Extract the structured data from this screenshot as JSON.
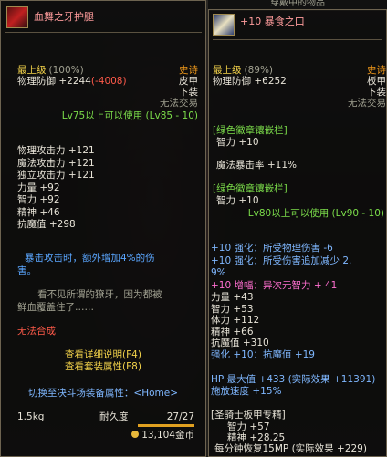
{
  "left": {
    "name": "血舞之牙护腿",
    "level_label": "最上级",
    "level_pct": "(100%)",
    "rarity": "史诗",
    "phys_def_label": "物理防御",
    "phys_def_val": "+2244",
    "phys_def_diff": "(-4008)",
    "material": "皮甲",
    "slot": "下装",
    "trade": "无法交易",
    "req": "Lv75以上可以使用 (Lv85 - 10)",
    "stats": [
      {
        "label": "物理攻击力",
        "val": "+121"
      },
      {
        "label": "魔法攻击力",
        "val": "+121"
      },
      {
        "label": "独立攻击力",
        "val": "+121"
      },
      {
        "label": "力量",
        "val": "+92"
      },
      {
        "label": "智力",
        "val": "+92"
      },
      {
        "label": "精神",
        "val": "+46"
      },
      {
        "label": "抗魔值",
        "val": "+298"
      }
    ],
    "effect1": "暴击攻击时，额外增加4%的伤",
    "effect2": "害。",
    "flavor1": "看不见所谓的獠牙，因为都被",
    "flavor2": "鲜血覆盖住了……",
    "no_synth": "无法合成",
    "link_detail": "查看详细说明(F4)",
    "link_set": "查看套装属性(F8)",
    "switch_label": "切换至决斗场装备属性：<Home>",
    "weight": "1.5kg",
    "durability_label": "耐久度",
    "durability_val": "27/27",
    "durability_fraction": 1.0,
    "price": "13,104金币"
  },
  "right": {
    "header": "穿戴中的物品",
    "name": "+10 暴食之口",
    "level_label": "最上级",
    "level_pct": "(89%)",
    "rarity": "史诗",
    "phys_def_label": "物理防御",
    "phys_def_val": "+6252",
    "material": "板甲",
    "slot": "下装",
    "trade": "无法交易",
    "slot1_title": "[绿色徽章镶嵌栏]",
    "slot1_stat": "智力 +10",
    "slot1_extra": "魔法暴击率 +11%",
    "slot2_title": "[绿色徽章镶嵌栏]",
    "slot2_stat": "智力 +10",
    "req": "Lv80以上可以使用 (Lv90 - 10)",
    "enh1": "+10 强化：所受物理伤害 -6",
    "enh2": "+10 强化：所受伤害追加减少 2.",
    "enh2b": "9%",
    "amp": "+10 增幅：异次元智力 + 41",
    "stats": [
      {
        "label": "力量",
        "val": "+43"
      },
      {
        "label": "智力",
        "val": "+53"
      },
      {
        "label": "体力",
        "val": "+112"
      },
      {
        "label": "精神",
        "val": "+66"
      },
      {
        "label": "抗魔值",
        "val": "+310"
      }
    ],
    "enh3": "强化 +10：抗魔值 +19",
    "hp_line": "HP 最大值 +433 (实际效果 +11391)",
    "cast_line": "施放速度 +15%",
    "spec_title": "[圣骑士板甲专精]",
    "spec_stats": [
      "智力 +57",
      "精神 +28.25",
      "每分钟恢复15MP (实际效果 +229)"
    ]
  },
  "colors": {
    "rarity": "#f29a1a",
    "green": "#7bdc4a",
    "red": "#ff5a4a",
    "blue": "#5aa6ff",
    "pink": "#ff6fd0"
  }
}
